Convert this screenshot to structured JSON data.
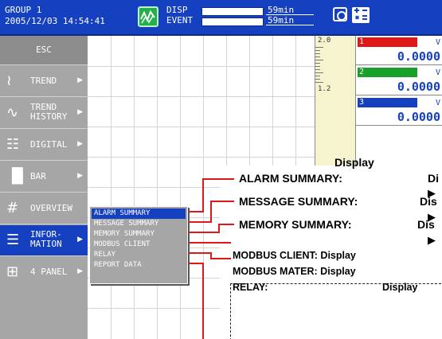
{
  "topbar": {
    "group": "GROUP 1",
    "datetime": "2005/12/03 14:54:41",
    "disp_label": "DISP",
    "event_label": "EVENT",
    "disp_remaining": "59min",
    "event_remaining": "59min"
  },
  "menu": {
    "esc": "ESC",
    "items": [
      {
        "label": "TREND",
        "icon": "trend-icon"
      },
      {
        "label_line1": "TREND",
        "label_line2": "HISTORY",
        "icon": "trend-history-icon"
      },
      {
        "label": "DIGITAL",
        "icon": "digital-icon"
      },
      {
        "label": "BAR",
        "icon": "bar-icon"
      },
      {
        "label": "OVERVIEW",
        "icon": "overview-icon"
      },
      {
        "label_line1": "INFOR-",
        "label_line2": "MATION",
        "icon": "information-icon",
        "selected": true
      },
      {
        "label": "4 PANEL",
        "icon": "four-panel-icon"
      }
    ]
  },
  "scale": {
    "top": "2.0",
    "mid": "1.2"
  },
  "panels": [
    {
      "number": "1",
      "unit": "V",
      "value": "0.0000",
      "color": "#e01818"
    },
    {
      "number": "2",
      "unit": "V",
      "value": "0.0000",
      "color": "#18a028"
    },
    {
      "number": "3",
      "unit": "V",
      "value": "0.0000",
      "color": "#1540c0"
    }
  ],
  "submenu": {
    "items": [
      "ALARM SUMMARY",
      "MESSAGE SUMMARY",
      "MEMORY SUMMARY",
      "MODBUS CLIENT",
      "RELAY",
      "REPORT DATA"
    ],
    "selected_index": 0
  },
  "annotations": {
    "title": "Display",
    "alarm": {
      "label": "ALARM SUMMARY:",
      "desc": "Di"
    },
    "message": {
      "label": "MESSAGE SUMMARY:",
      "desc": "Dis"
    },
    "memory": {
      "label": "MEMORY SUMMARY:",
      "desc": "Dis"
    },
    "modbus_client": "MODBUS CLIENT: Display",
    "modbus_master": "MODBUS MATER: Display",
    "relay": {
      "label": "RELAY:",
      "desc": "Display"
    }
  },
  "colors": {
    "accent_blue": "#1540c0",
    "menu_gray": "#a6a6a6",
    "annotation_red": "#e01818"
  }
}
